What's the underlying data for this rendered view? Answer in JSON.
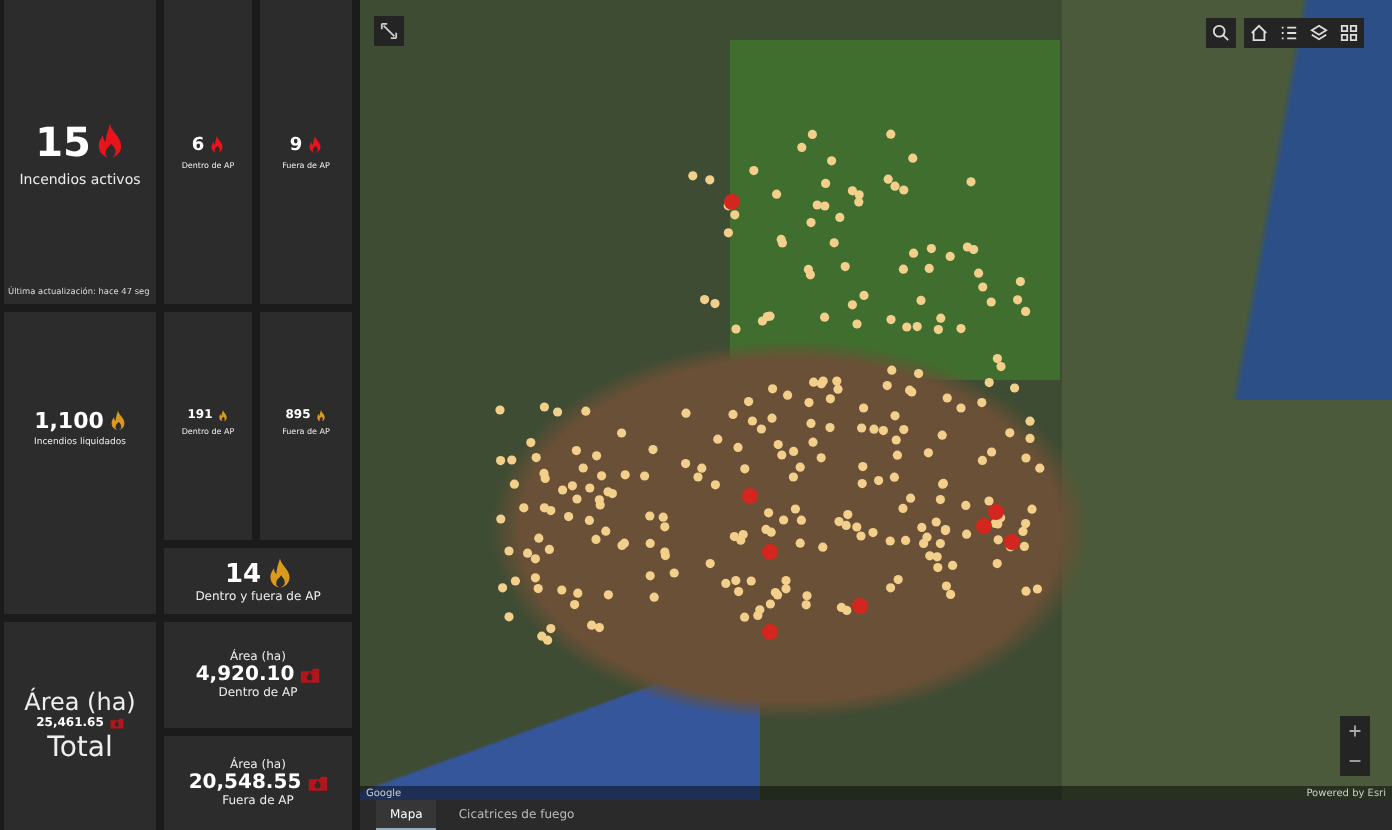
{
  "stats": [
    {
      "kind": "active",
      "value": "15",
      "label": "Incendios activos",
      "note": "Última actualización: hace 47 seg"
    },
    {
      "kind": "active",
      "value": "6",
      "label": "Dentro de AP"
    },
    {
      "kind": "active",
      "value": "9",
      "label": "Fuera de AP"
    },
    {
      "kind": "liquidated",
      "value": "1,100",
      "label": "Incendios liquidados"
    },
    {
      "kind": "liquidated",
      "value": "191",
      "label": "Dentro de AP"
    },
    {
      "kind": "liquidated",
      "value": "895",
      "label": "Fuera de AP"
    },
    {
      "kind": "liquidated",
      "value": "14",
      "label": "Dentro y fuera de AP"
    },
    {
      "kind": "area",
      "heading": "Área (ha)",
      "value": "25,461.65",
      "label": "Total"
    },
    {
      "kind": "area",
      "heading": "Área (ha)",
      "value": "4,920.10",
      "label": "Dentro de AP"
    },
    {
      "kind": "area",
      "heading": "Área (ha)",
      "value": "20,548.55",
      "label": "Fuera de AP"
    }
  ],
  "map": {
    "attribution_left": "Google",
    "attribution_right": "Powered by Esri"
  },
  "tabs": [
    {
      "label": "Mapa",
      "selected": true
    },
    {
      "label": "Cicatrices de fuego",
      "selected": false
    }
  ]
}
